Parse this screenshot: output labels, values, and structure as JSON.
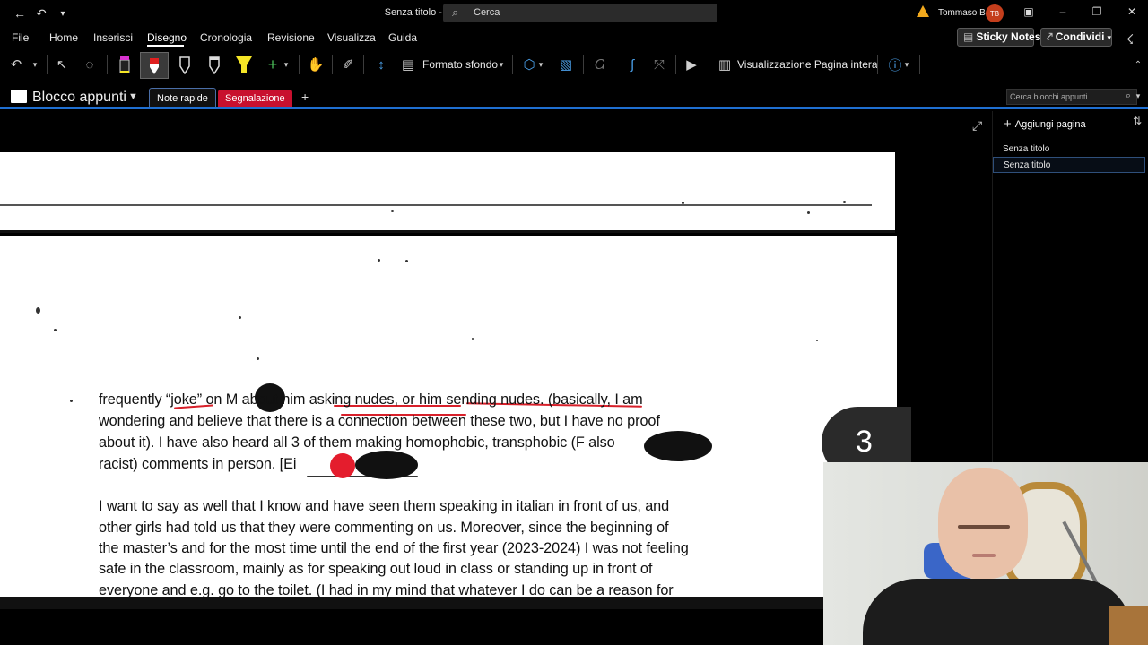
{
  "titlebar": {
    "document_title": "Senza titolo  -  OneNote",
    "search_placeholder": "Cerca",
    "user_name": "Tommaso B",
    "user_initials": "TB"
  },
  "menu": {
    "items": [
      "File",
      "Home",
      "Inserisci",
      "Disegno",
      "Cronologia",
      "Revisione",
      "Visualizza",
      "Guida"
    ],
    "active": "Disegno",
    "sticky_notes": "Sticky Notes",
    "share": "Condividi"
  },
  "toolbar": {
    "background_format": "Formato sfondo",
    "full_page_view": "Visualizzazione Pagina intera"
  },
  "notebook": {
    "title": "Blocco appunti",
    "tabs": [
      "Note rapide",
      "Segnalazione"
    ],
    "search_placeholder": "Cerca blocchi appunti"
  },
  "pages": {
    "add_label": "Aggiungi pagina",
    "items": [
      "Senza titolo",
      "Senza titolo"
    ]
  },
  "document": {
    "paragraph1": [
      "frequently “joke” on M      about him asking nudes, or him sending nudes. (basically, I am",
      "wondering and believe that there is a connection between these two, but I have no proof",
      "about it). I have also heard all 3 of them making homophobic, transphobic  (F            also",
      "racist) comments in person.  [Ei"
    ],
    "paragraph2": [
      "I want to say as well that I know and have seen them speaking in italian in front of us, and",
      "other girls had told us that they were commenting on us. Moreover, since the beginning of",
      "the master’s and for the most time until the end of the first year (2023-2024) I was not feeling",
      "safe in the classroom, mainly as for speaking out loud in class or standing up in front of",
      "everyone and e.g. go to the toilet. (I had in my mind that whatever I do can be a reason for"
    ],
    "page_number": "3"
  },
  "colors": {
    "accent_blue": "#1f6fd1",
    "flag_tab_red": "#c8102e",
    "ink_red": "#d8202a",
    "highlighter_yellow": "#f5e626"
  },
  "icons": [
    "back-icon",
    "undo-icon",
    "customize-icon",
    "search-icon",
    "warning-icon",
    "lasso-icon",
    "hand-icon",
    "eraser-icon",
    "pen-icon",
    "highlighter-icon",
    "replay-icon",
    "help-icon",
    "expand-icon",
    "sort-icon"
  ]
}
